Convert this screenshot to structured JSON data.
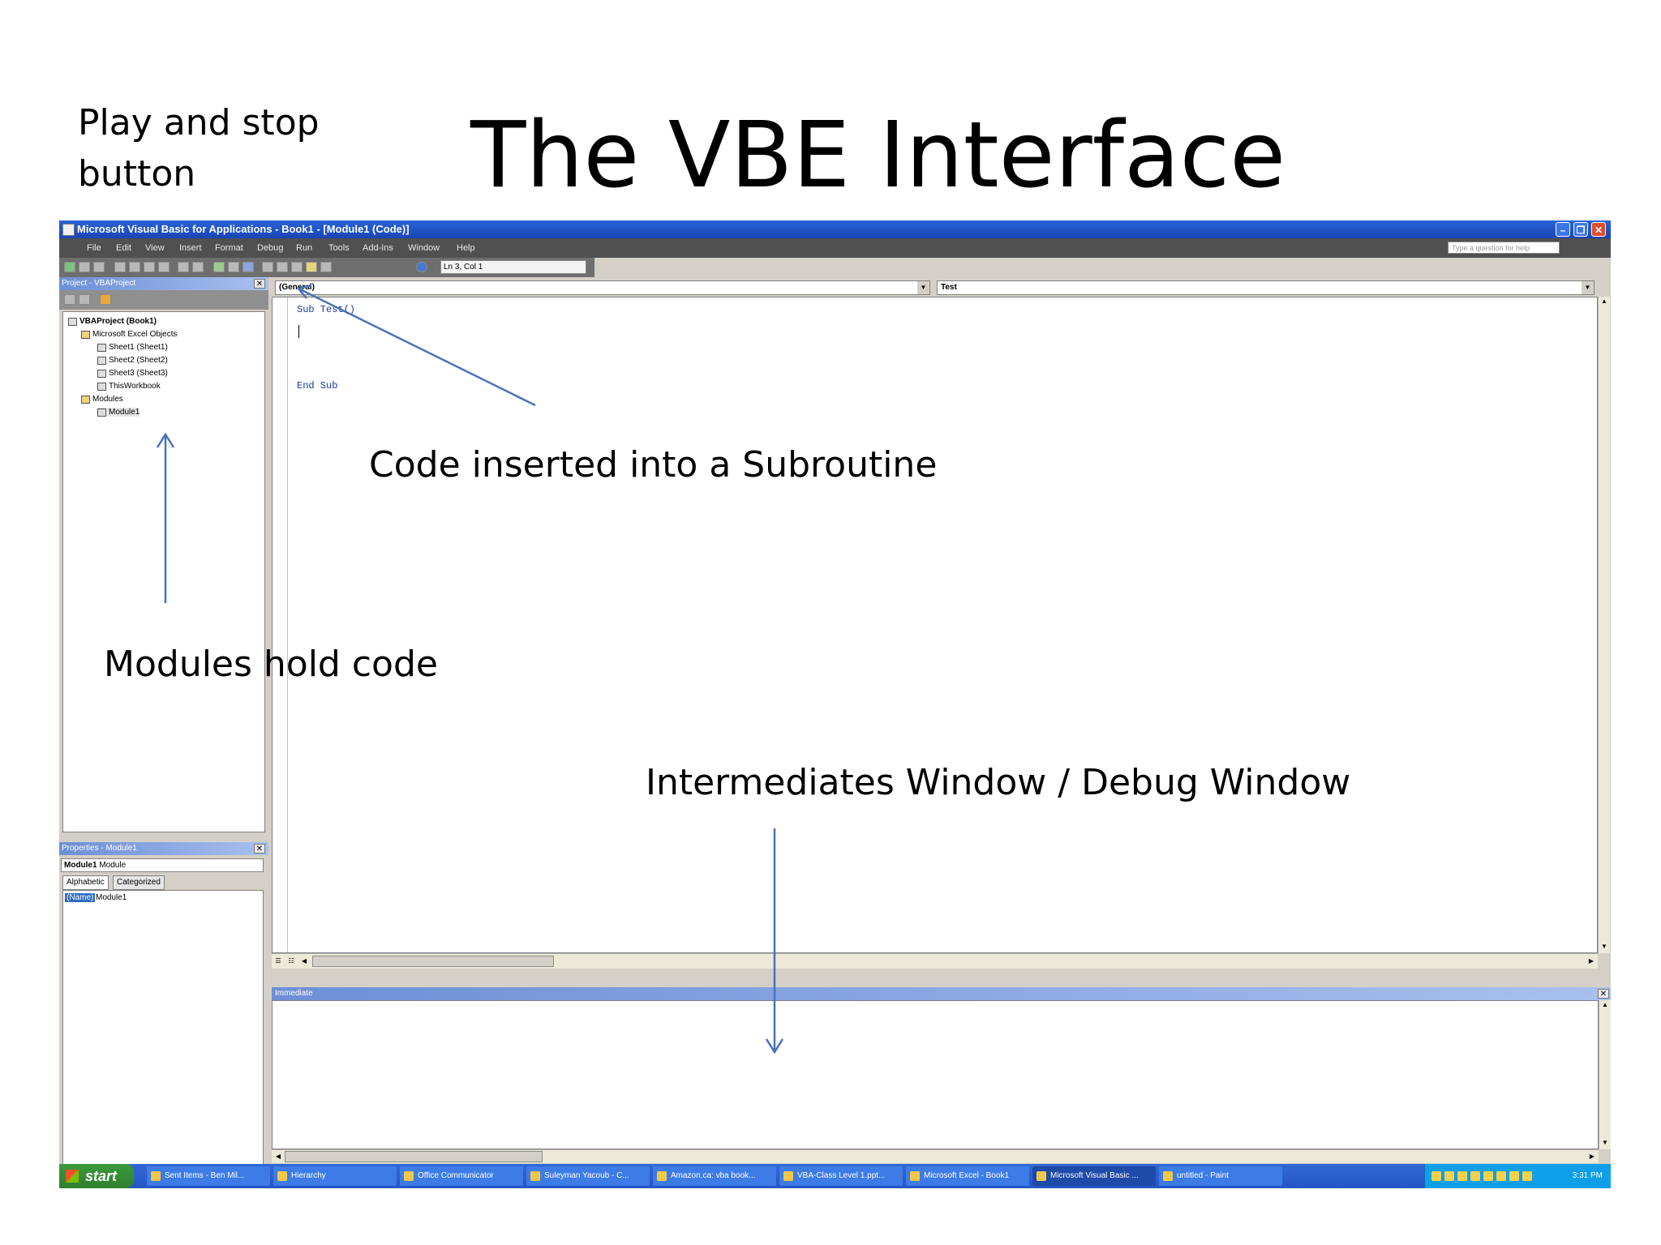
{
  "slide": {
    "title": "The VBE Interface",
    "note_play": "Play and stop button",
    "note_code": "Code inserted into a Subroutine",
    "note_modules": "Modules hold code",
    "note_immediate": "Intermediates Window / Debug Window"
  },
  "window": {
    "title": "Microsoft Visual Basic for Applications - Book1 - [Module1 (Code)]"
  },
  "menu": [
    "File",
    "Edit",
    "View",
    "Insert",
    "Format",
    "Debug",
    "Run",
    "Tools",
    "Add-Ins",
    "Window",
    "Help"
  ],
  "help_placeholder": "Type a question for help",
  "toolbar": {
    "position": "Ln 3, Col 1"
  },
  "project": {
    "title": "Project - VBAProject",
    "root": "VBAProject (Book1)",
    "excel_objects": "Microsoft Excel Objects",
    "sheet1": "Sheet1 (Sheet1)",
    "sheet2": "Sheet2 (Sheet2)",
    "sheet3": "Sheet3 (Sheet3)",
    "workbook": "ThisWorkbook",
    "modules": "Modules",
    "module1": "Module1"
  },
  "properties": {
    "title": "Properties - Module1",
    "object": "Module1",
    "object_type": "Module",
    "tab_alphabetic": "Alphabetic",
    "tab_categorized": "Categorized",
    "prop_name": "(Name)",
    "prop_value": "Module1"
  },
  "code": {
    "object_combo": "(General)",
    "proc_combo": "Test",
    "line1": "Sub Test()",
    "line2": "End Sub"
  },
  "immediate": {
    "title": "Immediate"
  },
  "taskbar": {
    "start": "start",
    "items": [
      "Sent Items - Ben Mil...",
      "Hierarchy",
      "Office Communicator",
      "Suleyman Yacoub - C...",
      "Amazon.ca: vba book...",
      "VBA-Class Level 1.ppt...",
      "Microsoft Excel - Book1",
      "Microsoft Visual Basic ...",
      "untitled - Paint"
    ],
    "time": "3:31 PM"
  },
  "colors": {
    "titlebar": "#1945b4",
    "annotation_arrow": "#4a72b8",
    "code_keyword": "#1a3aa0"
  }
}
